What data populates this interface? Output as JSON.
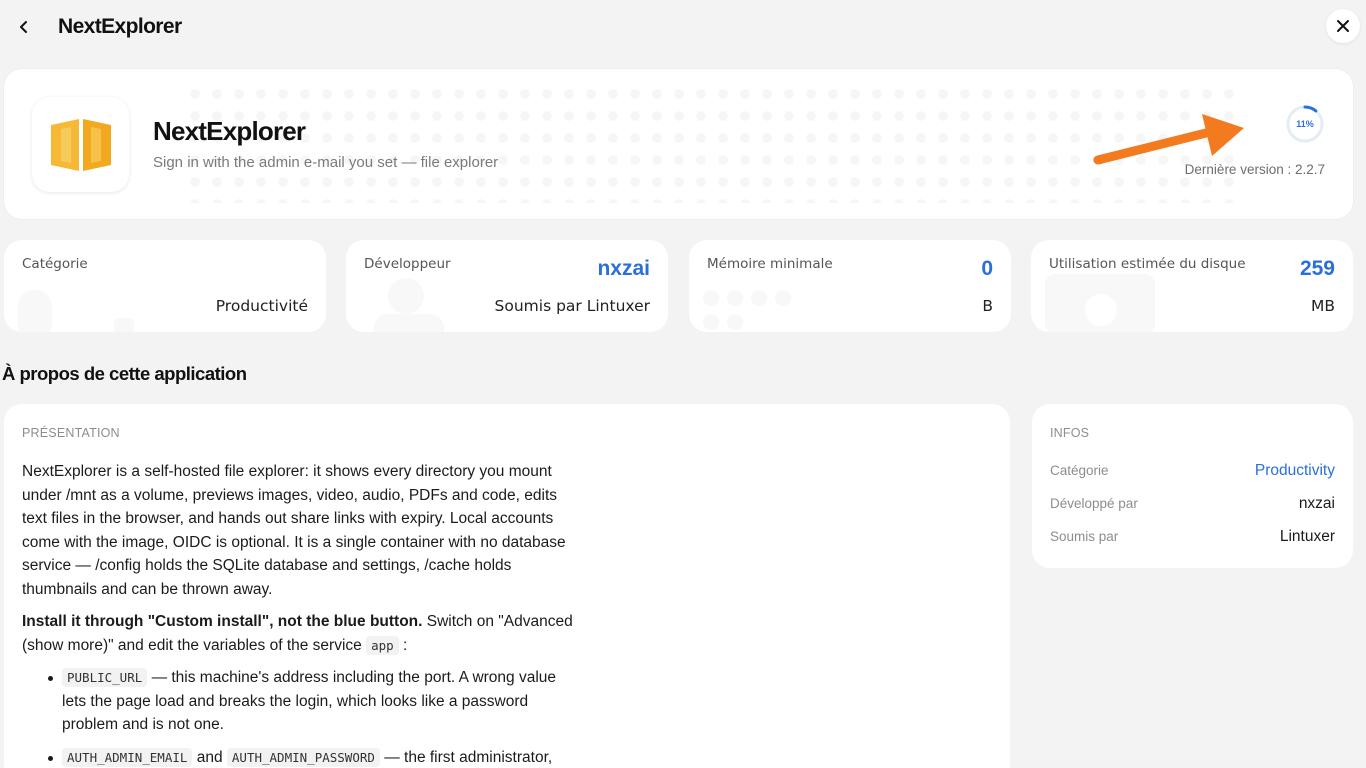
{
  "topbar": {
    "title": "NextExplorer"
  },
  "app": {
    "name": "NextExplorer",
    "tagline": "Sign in with the admin e-mail you set — file explorer",
    "progress": 0.11,
    "progress_label": "11%",
    "latest_version": "Dernière version : 2.2.7"
  },
  "stats": [
    {
      "label": "Catégorie",
      "value": "Productivité",
      "accent": ""
    },
    {
      "label": "Développeur",
      "value": "Soumis par Lintuxer",
      "accent": "nxzai"
    },
    {
      "label": "Mémoire minimale",
      "value": "B",
      "accent": "0"
    },
    {
      "label": "Utilisation estimée du disque",
      "value": "MB",
      "accent": "259"
    }
  ],
  "about": {
    "section_title": "À propos de cette application",
    "heading": "PRÉSENTATION",
    "intro": "NextExplorer is a self-hosted file explorer: it shows every directory you mount under /mnt as a volume, previews images, video, audio, PDFs and code, edits text files in the browser, and hands out share links with expiry. Local accounts come with the image, OIDC is optional. It is a single container with no database service — /config holds the SQLite database and settings, /cache holds thumbnails and can be thrown away.",
    "install_bold": "Install it through \"Custom install\", not the blue button.",
    "install_rest": " Switch on \"Advanced (show more)\" and edit the variables of the service ",
    "install_code": "app",
    "install_end": " :",
    "bullets": [
      {
        "code": "PUBLIC_URL",
        "text": " — this machine's address including the port. A wrong value lets the page load and breaks the login, which looks like a password problem and is not one."
      },
      {
        "code": "AUTH_ADMIN_EMAIL",
        "mid": " and ",
        "code2": "AUTH_ADMIN_PASSWORD",
        "text": " — the first administrator,"
      }
    ]
  },
  "infos": {
    "heading": "INFOS",
    "rows": [
      {
        "key": "Catégorie",
        "value": "Productivity"
      },
      {
        "key": "Développé par",
        "value": "nxzai"
      },
      {
        "key": "Soumis par",
        "value": "Lintuxer"
      }
    ]
  },
  "colors": {
    "accent": "#2a6fdb",
    "arrow": "#f47a20",
    "icon": "#f5b936"
  },
  "icons": {
    "back": "chevron-left-icon",
    "close": "close-icon",
    "app": "book-open-icon"
  }
}
